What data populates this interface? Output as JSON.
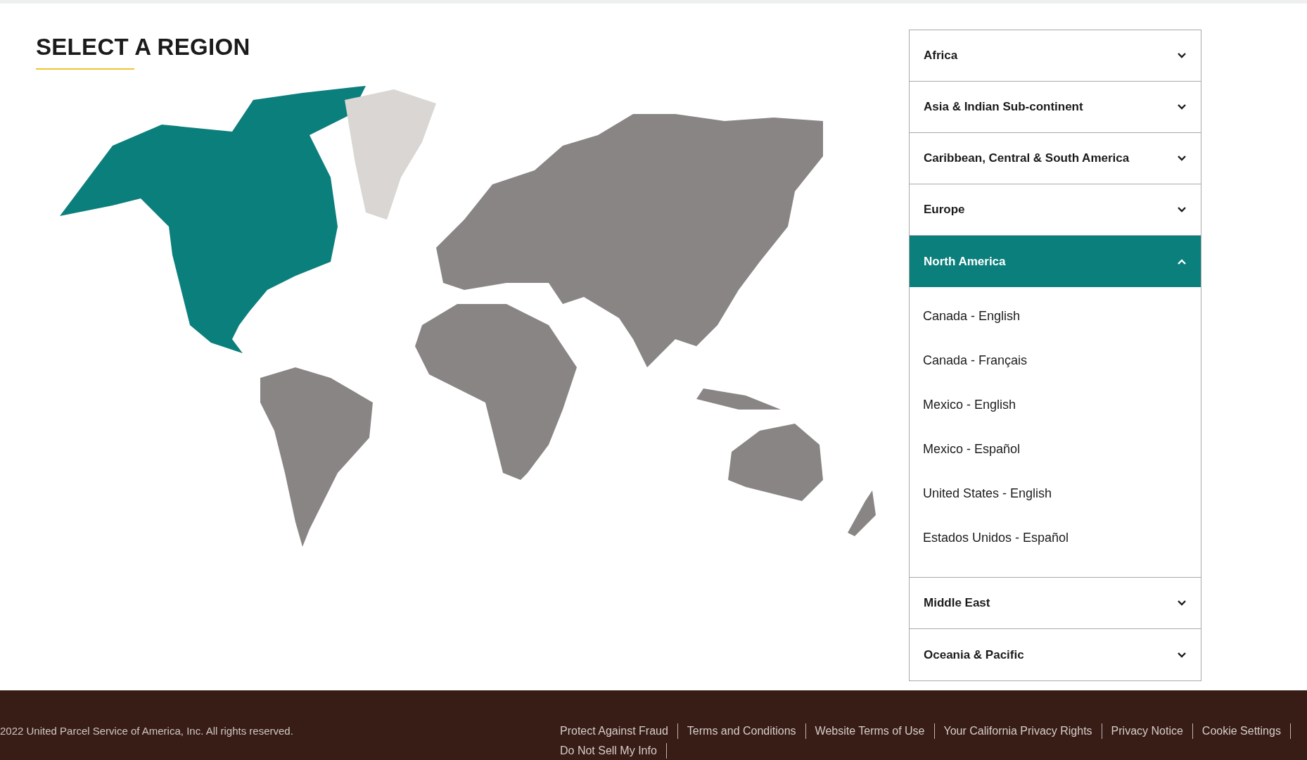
{
  "title": "SELECT A REGION",
  "regions": [
    {
      "name": "Africa",
      "expanded": false
    },
    {
      "name": "Asia & Indian Sub-continent",
      "expanded": false
    },
    {
      "name": "Caribbean, Central & South America",
      "expanded": false
    },
    {
      "name": "Europe",
      "expanded": false
    },
    {
      "name": "North America",
      "expanded": true,
      "countries": [
        "Canada - English",
        "Canada - Français",
        "Mexico - English",
        "Mexico - Español",
        "United States - English",
        "Estados Unidos - Español"
      ]
    },
    {
      "name": "Middle East",
      "expanded": false
    },
    {
      "name": "Oceania & Pacific",
      "expanded": false
    }
  ],
  "footer": {
    "copyright": "2022  United Parcel Service of America, Inc. All rights reserved.",
    "links": [
      "Protect Against Fraud",
      "Terms and Conditions",
      "Website Terms of Use",
      "Your California Privacy Rights",
      "Privacy Notice",
      "Cookie Settings",
      "Do Not Sell My Info"
    ]
  }
}
